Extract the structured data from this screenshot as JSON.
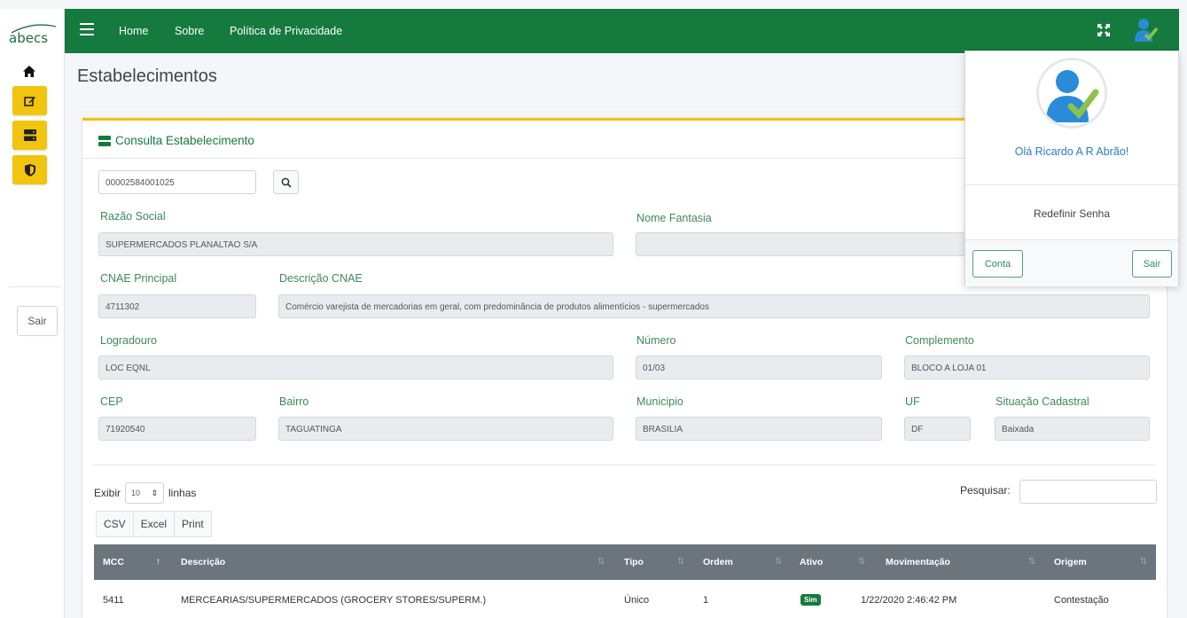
{
  "brand": {
    "logo_text": "abecs"
  },
  "sidebar": {
    "sair_label": "Sair"
  },
  "nav": {
    "links": [
      "Home",
      "Sobre",
      "Política de Privacidade"
    ]
  },
  "page": {
    "title": "Estabelecimentos"
  },
  "card": {
    "title": "Consulta Estabelecimento"
  },
  "form": {
    "search_value": "00002584001025",
    "razao_social": {
      "label": "Razão Social",
      "value": "SUPERMERCADOS PLANALTAO S/A"
    },
    "nome_fantasia": {
      "label": "Nome Fantasia",
      "value": ""
    },
    "cnae_principal": {
      "label": "CNAE Principal",
      "value": "4711302"
    },
    "descricao_cnae": {
      "label": "Descrição CNAE",
      "value": "Comércio varejista de mercadorias em geral, com predominância de produtos alimentícios - supermercados"
    },
    "logradouro": {
      "label": "Logradouro",
      "value": "LOC EQNL"
    },
    "numero": {
      "label": "Número",
      "value": "01/03"
    },
    "complemento": {
      "label": "Complemento",
      "value": "BLOCO A LOJA 01"
    },
    "cep": {
      "label": "CEP",
      "value": "71920540"
    },
    "bairro": {
      "label": "Bairro",
      "value": "TAGUATINGA"
    },
    "municipio": {
      "label": "Municipio",
      "value": "BRASILIA"
    },
    "uf": {
      "label": "UF",
      "value": "DF"
    },
    "situacao": {
      "label": "Situação Cadastral",
      "value": "Baixada"
    }
  },
  "table_controls": {
    "exibir": "Exibir",
    "page_size": "10",
    "linhas": "linhas",
    "pesquisar": "Pesquisar:",
    "buttons": [
      "CSV",
      "Excel",
      "Print"
    ]
  },
  "table": {
    "columns": [
      "MCC",
      "Descrição",
      "Tipo",
      "Ordem",
      "Ativo",
      "Movimentação",
      "Origem"
    ],
    "rows": [
      {
        "mcc": "5411",
        "descricao": "MERCEARIAS/SUPERMERCADOS (GROCERY STORES/SUPERM.)",
        "tipo": "Único",
        "ordem": "1",
        "ativo": "Sim",
        "movimentacao": "1/22/2020 2:46:42 PM",
        "origem": "Contestação"
      }
    ]
  },
  "user_menu": {
    "greeting": "Olá Ricardo A R Abrão!",
    "redefinir": "Redefinir Senha",
    "conta": "Conta",
    "sair": "Sair"
  },
  "colors": {
    "primary_green": "#157a3e",
    "accent_yellow": "#f1c40f",
    "table_header": "#6c757d",
    "link_blue": "#2a7bc3"
  }
}
